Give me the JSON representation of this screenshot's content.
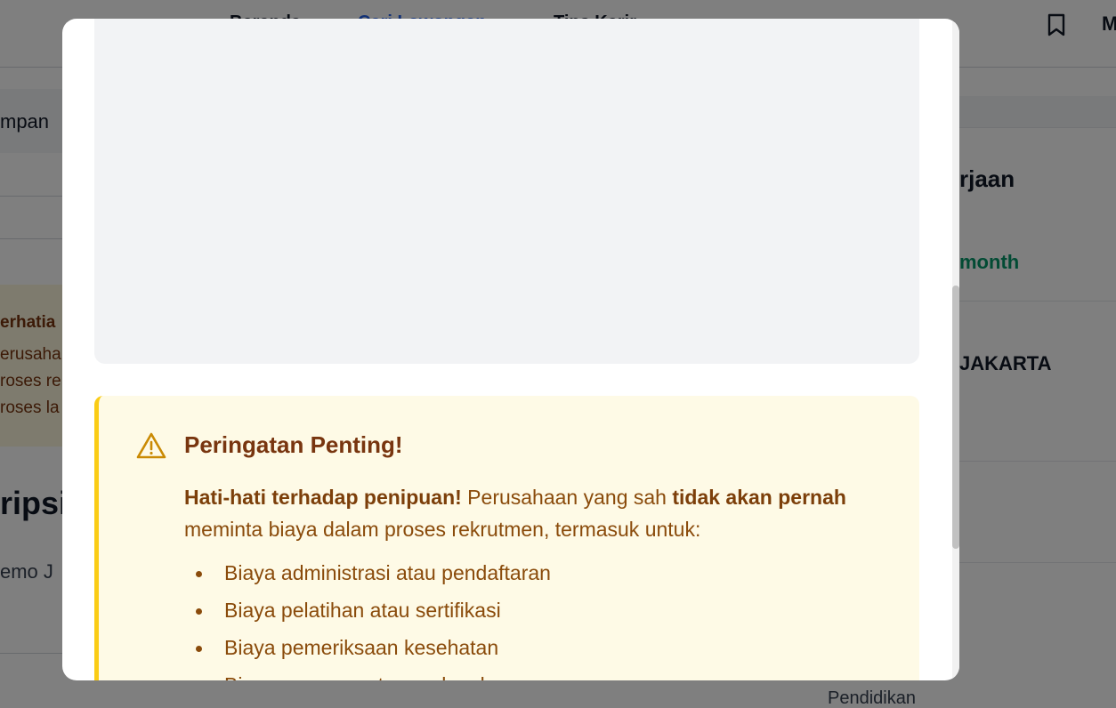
{
  "background": {
    "nav_links": [
      "Beranda",
      "Cari Lowongan",
      "Tips Karir"
    ],
    "nav_trailing": "M",
    "simpan_label": "mpan",
    "notice": {
      "title": "erhatia",
      "lines": [
        "erusaha",
        "roses re",
        "roses la"
      ]
    },
    "section_heading": "ripsi",
    "section_sub": "emo J",
    "right": {
      "heading": "rjaan",
      "salary": "month",
      "location": "JAKARTA",
      "education": "Pendidikan"
    }
  },
  "modal": {
    "warning": {
      "icon": "warning-triangle-icon",
      "title": "Peringatan Penting!",
      "body": {
        "strong1": "Hati-hati terhadap penipuan!",
        "text1": " Perusahaan yang sah ",
        "strong2": "tidak akan pernah",
        "text2": " meminta biaya dalam proses rekrutmen, termasuk untuk:"
      },
      "items": [
        "Biaya administrasi atau pendaftaran",
        "Biaya pelatihan atau sertifikasi",
        "Biaya pemeriksaan kesehatan",
        "Biaya seragam atau perlengkapan"
      ]
    }
  },
  "colors": {
    "accent_link": "#2563eb",
    "warning_border": "#facc15",
    "warning_bg": "#fefae6",
    "warning_text": "#8a4b0b",
    "salary_green": "#059669"
  }
}
